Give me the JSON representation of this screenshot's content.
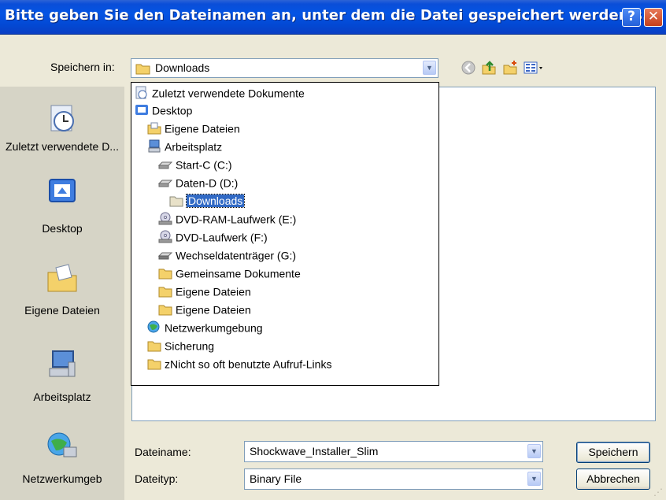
{
  "window": {
    "title": "Bitte geben Sie den Dateinamen an, unter dem die Datei gespeichert werden s...",
    "help_glyph": "?",
    "close_glyph": "✕"
  },
  "save_in": {
    "label": "Speichern in:",
    "value": "Downloads"
  },
  "toolbar": {
    "icons": [
      "back-icon",
      "up-folder-icon",
      "new-folder-icon",
      "views-menu-icon"
    ]
  },
  "places_bar": {
    "items": [
      {
        "label": "Zuletzt verwendete D...",
        "icon": "recent-documents-icon"
      },
      {
        "label": "Desktop",
        "icon": "desktop-icon"
      },
      {
        "label": "Eigene Dateien",
        "icon": "my-documents-icon"
      },
      {
        "label": "Arbeitsplatz",
        "icon": "my-computer-icon"
      },
      {
        "label": "Netzwerkumgeb",
        "icon": "network-places-icon"
      }
    ]
  },
  "location_dropdown": {
    "items": [
      {
        "label": "Zuletzt verwendete Dokumente",
        "icon": "recent-documents-icon",
        "indent": 0
      },
      {
        "label": "Desktop",
        "icon": "desktop-icon",
        "indent": 0
      },
      {
        "label": "Eigene Dateien",
        "icon": "my-documents-icon",
        "indent": 1
      },
      {
        "label": "Arbeitsplatz",
        "icon": "my-computer-icon",
        "indent": 1
      },
      {
        "label": "Start-C (C:)",
        "icon": "hard-drive-icon",
        "indent": 2
      },
      {
        "label": "Daten-D (D:)",
        "icon": "hard-drive-icon",
        "indent": 2
      },
      {
        "label": "Downloads",
        "icon": "folder-icon",
        "indent": 3,
        "selected": true
      },
      {
        "label": "DVD-RAM-Laufwerk (E:)",
        "icon": "dvd-drive-icon",
        "indent": 2
      },
      {
        "label": "DVD-Laufwerk (F:)",
        "icon": "dvd-drive-icon",
        "indent": 2
      },
      {
        "label": "Wechseldatenträger (G:)",
        "icon": "removable-drive-icon",
        "indent": 2
      },
      {
        "label": "Gemeinsame Dokumente",
        "icon": "folder-icon",
        "indent": 2
      },
      {
        "label": "Eigene Dateien",
        "icon": "folder-icon",
        "indent": 2
      },
      {
        "label": "Eigene Dateien",
        "icon": "folder-icon",
        "indent": 2
      },
      {
        "label": "Netzwerkumgebung",
        "icon": "network-places-icon",
        "indent": 1
      },
      {
        "label": "Sicherung",
        "icon": "folder-icon",
        "indent": 1
      },
      {
        "label": "zNicht so oft benutzte Aufruf-Links",
        "icon": "folder-icon",
        "indent": 1
      }
    ]
  },
  "filename": {
    "label": "Dateiname:",
    "value": "Shockwave_Installer_Slim"
  },
  "filetype": {
    "label": "Dateityp:",
    "value": "Binary File"
  },
  "buttons": {
    "save": "Speichern",
    "cancel": "Abbrechen"
  },
  "colors": {
    "titlebar": "#0454e4",
    "dialog_bg": "#ece9d8",
    "selection": "#316ac5",
    "folder": "#f4d16a"
  }
}
